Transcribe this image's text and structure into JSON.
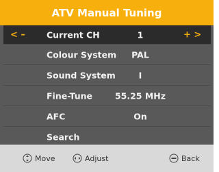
{
  "title": "ATV Manual Tuning",
  "colors": {
    "accent": "#f7af0d",
    "panel": "#595959",
    "selected_row": "#2b2b2b",
    "footer": "#d9d9d9"
  },
  "rows": [
    {
      "label": "Current CH",
      "value": "1",
      "nav_left": "< –",
      "nav_right": "+ >"
    },
    {
      "label": "Colour System",
      "value": "PAL"
    },
    {
      "label": "Sound System",
      "value": "I"
    },
    {
      "label": "Fine-Tune",
      "value": "55.25 MHz"
    },
    {
      "label": "AFC",
      "value": "On"
    },
    {
      "label": "Search",
      "value": ""
    }
  ],
  "footer": {
    "move": "Move",
    "adjust": "Adjust",
    "back": "Back",
    "move_icon": "dpad-updown-icon",
    "adjust_icon": "dpad-leftright-icon",
    "back_icon": "back-button-icon"
  }
}
